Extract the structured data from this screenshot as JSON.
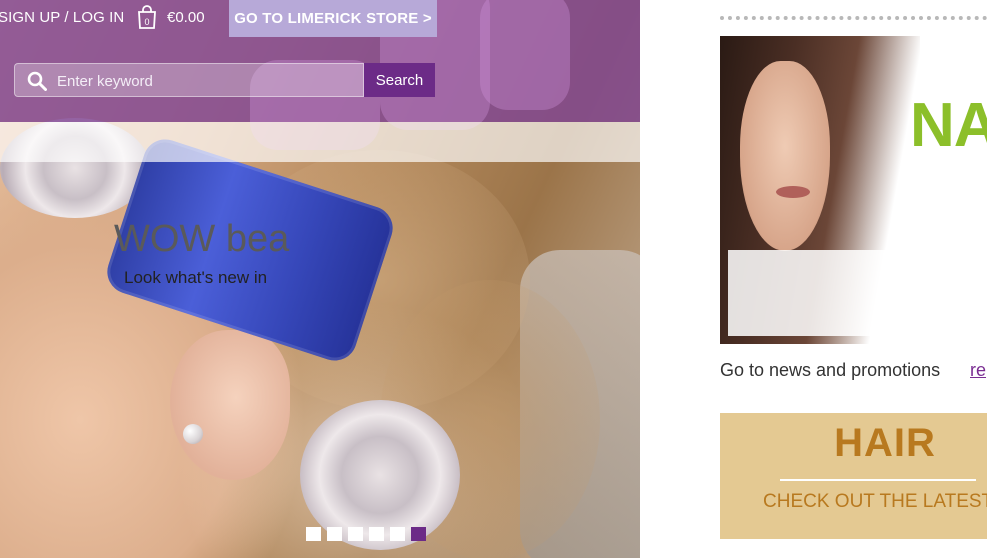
{
  "header": {
    "login_label": "SIGN UP / LOG IN",
    "cart_count": "0",
    "cart_total": "€0.00",
    "store_button_label": "GO TO LIMERICK STORE >"
  },
  "search": {
    "placeholder": "Enter keyword",
    "button_label": "Search"
  },
  "hero": {
    "slide_count": 6,
    "active_slide": 6
  },
  "sidebar": {
    "promo": {
      "brand_fragment": "NA BE",
      "title": "WOW bea",
      "subtitle": "Look what's new in"
    },
    "news_text": "Go to news and promotions",
    "news_link": "re",
    "hair_box": {
      "title": "HAIR",
      "subtitle": "CHECK OUT THE LATEST TR"
    }
  },
  "colors": {
    "brand_purple": "#6c2b87",
    "header_purple": "#8046a0",
    "store_button": "#b7a9d8",
    "hair_box_bg": "#e4c992",
    "hair_box_text": "#b8791f",
    "promo_brand_green": "#8cbf2a"
  },
  "icons": {
    "cart": "shopping-bag-icon",
    "search": "magnifier-icon"
  }
}
